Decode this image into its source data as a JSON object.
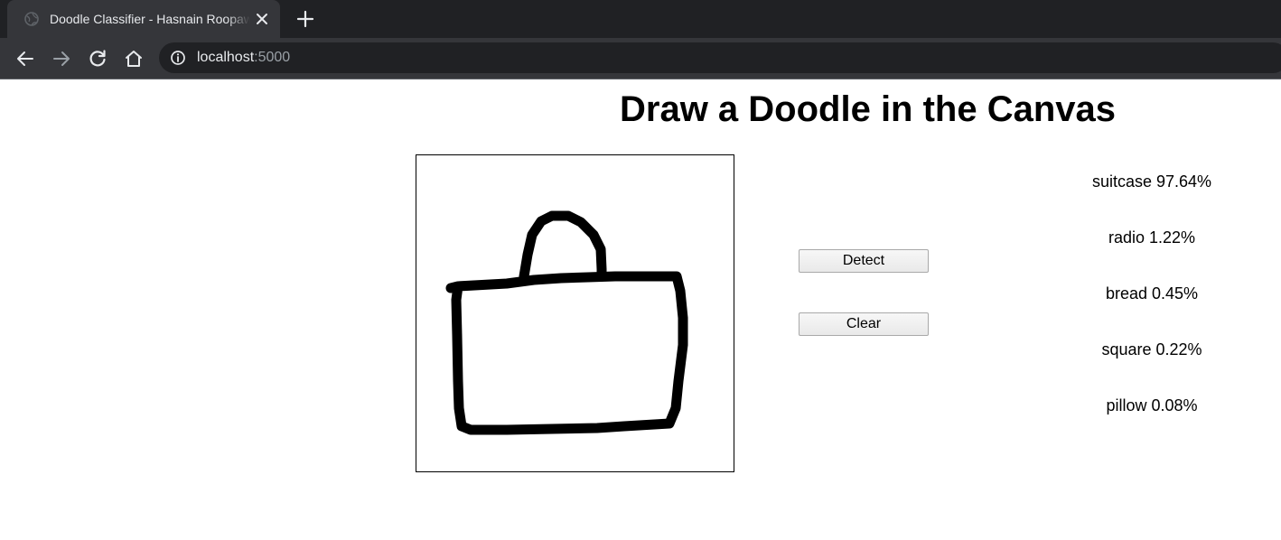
{
  "browser": {
    "tab": {
      "title": "Doodle Classifier - Hasnain Roopawalla",
      "favicon": "globe-icon",
      "close_icon": "close-icon"
    },
    "new_tab_icon": "plus-icon",
    "nav": {
      "back_icon": "arrow-left-icon",
      "forward_icon": "arrow-right-icon",
      "reload_icon": "reload-icon",
      "home_icon": "home-icon"
    },
    "address_bar": {
      "info_icon": "info-icon",
      "host": "localhost",
      "port": ":5000"
    },
    "colors": {
      "tabstrip": "#202124",
      "toolbar": "#35363a",
      "text": "#e8eaed",
      "muted_text": "#9aa0a6"
    }
  },
  "page": {
    "title": "Draw a Doodle in the Canvas",
    "canvas": {
      "drawing": "suitcase doodle (black strokes on white)"
    },
    "buttons": {
      "detect": "Detect",
      "clear": "Clear"
    },
    "predictions": [
      {
        "label": "suitcase",
        "percent": "97.64%"
      },
      {
        "label": "radio",
        "percent": "1.22%"
      },
      {
        "label": "bread",
        "percent": "0.45%"
      },
      {
        "label": "square",
        "percent": "0.22%"
      },
      {
        "label": "pillow",
        "percent": "0.08%"
      }
    ]
  }
}
